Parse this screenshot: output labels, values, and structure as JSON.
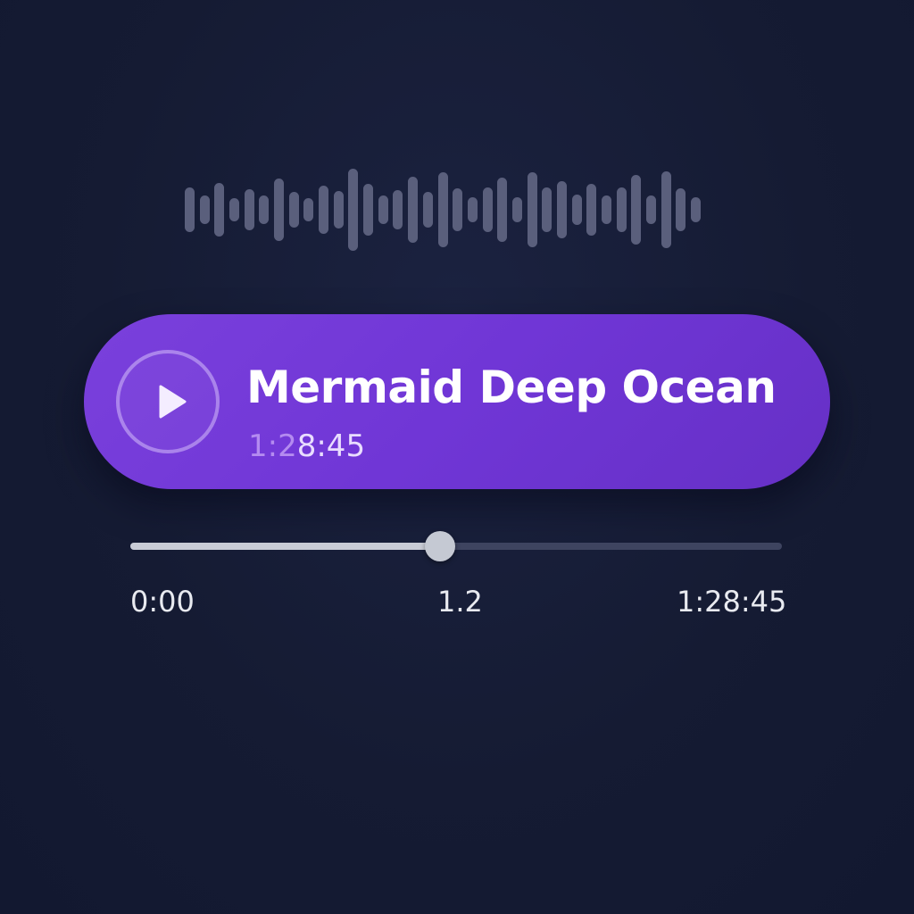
{
  "waveform": {
    "icon": "waveform-icon",
    "color": "#5a5f7c",
    "levels": [
      0.52,
      0.33,
      0.62,
      0.28,
      0.48,
      0.33,
      0.72,
      0.42,
      0.28,
      0.56,
      0.44,
      0.95,
      0.6,
      0.33,
      0.46,
      0.78,
      0.42,
      0.87,
      0.5,
      0.3,
      0.52,
      0.74,
      0.3,
      0.87,
      0.52,
      0.66,
      0.36,
      0.6,
      0.33,
      0.52,
      0.82,
      0.33,
      0.9,
      0.5,
      0.3
    ]
  },
  "player": {
    "accent_color": "#7a40dc",
    "play_icon": "play-icon",
    "title": "Mermaid Deep Ocean",
    "duration_prefix": "1:2",
    "duration_suffix": "8:45"
  },
  "progress": {
    "fraction": 0.475,
    "start_label": "0:00",
    "current_label": "1.2",
    "end_label": "1:28:45"
  }
}
